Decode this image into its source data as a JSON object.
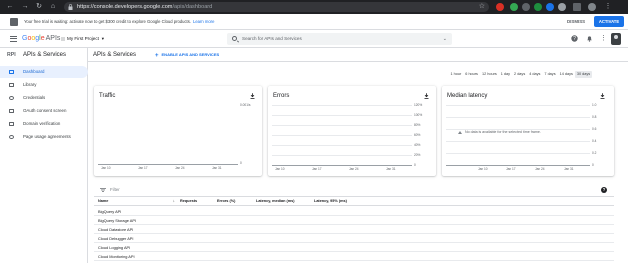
{
  "browser": {
    "url_host": "https://console.developers.google.com",
    "url_path": "/apis/dashboard"
  },
  "promo": {
    "text": "Your free trial is waiting: activate now to get $300 credit to explore Google Cloud products.",
    "learn_more": "Learn more",
    "dismiss": "DISMISS",
    "activate": "ACTIVATE"
  },
  "header": {
    "logo_google": [
      "G",
      "o",
      "o",
      "g",
      "l",
      "e"
    ],
    "logo_apis": "APIs",
    "project": "My First Project",
    "search_placeholder": "Search for APIs and Services"
  },
  "sidebar": {
    "badge": "RPI",
    "title": "APIs & Services",
    "items": [
      {
        "label": "Dashboard",
        "icon": "dashboard-icon",
        "active": true
      },
      {
        "label": "Library",
        "icon": "library-icon",
        "active": false
      },
      {
        "label": "Credentials",
        "icon": "key-icon",
        "active": false
      },
      {
        "label": "OAuth consent screen",
        "icon": "consent-icon",
        "active": false
      },
      {
        "label": "Domain verification",
        "icon": "checkbox-icon",
        "active": false
      },
      {
        "label": "Page usage agreements",
        "icon": "settings-icon",
        "active": false
      }
    ]
  },
  "main": {
    "title": "APIs & Services",
    "enable_button": "ENABLE APIS AND SERVICES",
    "time_ranges": [
      "1 hour",
      "6 hours",
      "12 hours",
      "1 day",
      "2 days",
      "4 days",
      "7 days",
      "14 days",
      "30 days"
    ],
    "selected_range": "30 days"
  },
  "cards": {
    "traffic": {
      "title": "Traffic",
      "y_ticks": [
        "0.001/s",
        "0"
      ],
      "x_ticks": [
        "Jan 10",
        "Jan 17",
        "Jan 24",
        "Jan 31"
      ]
    },
    "errors": {
      "title": "Errors",
      "y_ticks": [
        "120%",
        "100%",
        "80%",
        "60%",
        "40%",
        "20%",
        "0"
      ],
      "x_ticks": [
        "Jan 10",
        "Jan 17",
        "Jan 24",
        "Jan 31"
      ]
    },
    "latency": {
      "title": "Median latency",
      "y_ticks": [
        "1.0",
        "0.8",
        "0.6",
        "0.4",
        "0.2",
        "0"
      ],
      "x_ticks": [
        "Jan 10",
        "Jan 17",
        "Jan 24",
        "Jan 31"
      ],
      "no_data": "No data is available for the selected time frame."
    }
  },
  "table": {
    "filter_placeholder": "Filter",
    "help": "?",
    "columns": [
      "Name",
      "Requests",
      "Errors (%)",
      "Latency, median (ms)",
      "Latency, 95% (ms)"
    ],
    "rows": [
      "BigQuery API",
      "BigQuery Storage API",
      "Cloud Datastore API",
      "Cloud Debugger API",
      "Cloud Logging API",
      "Cloud Monitoring API"
    ]
  },
  "colors": {
    "accent": "#1a73e8",
    "active_bg": "#e8f0fe",
    "browser_dark": "#202124"
  }
}
